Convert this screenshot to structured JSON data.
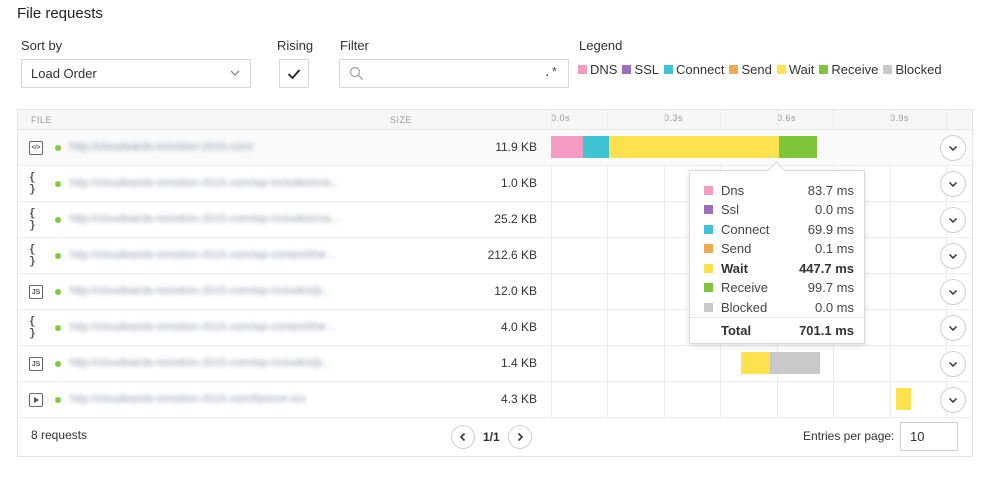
{
  "title": "File requests",
  "controls": {
    "sort_label": "Sort by",
    "sort_value": "Load Order",
    "rising_label": "Rising",
    "filter_label": "Filter",
    "filter_value": "",
    "filter_regex": ".*",
    "legend_label": "Legend"
  },
  "legend": [
    {
      "name": "DNS",
      "color": "#f49bc4"
    },
    {
      "name": "SSL",
      "color": "#9b6fbe"
    },
    {
      "name": "Connect",
      "color": "#3fc4d4"
    },
    {
      "name": "Send",
      "color": "#f0ab4e"
    },
    {
      "name": "Wait",
      "color": "#fde24d"
    },
    {
      "name": "Receive",
      "color": "#7fc53a"
    },
    {
      "name": "Blocked",
      "color": "#c9c9c9"
    }
  ],
  "table": {
    "col_file": "FILE",
    "col_size": "SIZE",
    "ticks": [
      "0.0s",
      "0.3s",
      "0.6s",
      "0.9s"
    ],
    "rows": [
      {
        "icon": "html",
        "url": "http://cloudwards-inmotion-2015.com/",
        "size": "11.9 KB",
        "bars": [
          {
            "type": "dns",
            "start": 0,
            "dur": 0.0837
          },
          {
            "type": "connect",
            "start": 0.0837,
            "dur": 0.0699
          },
          {
            "type": "send",
            "start": 0.1536,
            "dur": 0.0001
          },
          {
            "type": "wait",
            "start": 0.1537,
            "dur": 0.4477
          },
          {
            "type": "receive",
            "start": 0.6014,
            "dur": 0.0997
          }
        ]
      },
      {
        "icon": "json",
        "url": "http://cloudwards-inmotion-2015.com/wp-includes/css...",
        "size": "1.0 KB",
        "bars": []
      },
      {
        "icon": "json",
        "url": "http://cloudwards-inmotion-2015.com/wp-includes/css...",
        "size": "25.2 KB",
        "bars": []
      },
      {
        "icon": "json",
        "url": "http://cloudwards-inmotion-2015.com/wp-content/the...",
        "size": "212.6 KB",
        "bars": [
          {
            "type": "receive",
            "start": 0.72,
            "dur": 0.028
          },
          {
            "type": "blocked",
            "start": 0.748,
            "dur": 0.062
          }
        ]
      },
      {
        "icon": "js",
        "url": "http://cloudwards-inmotion-2015.com/wp-includes/js...",
        "size": "12.0 KB",
        "bars": []
      },
      {
        "icon": "json",
        "url": "http://cloudwards-inmotion-2015.com/wp-content/the...",
        "size": "4.0 KB",
        "bars": []
      },
      {
        "icon": "js",
        "url": "http://cloudwards-inmotion-2015.com/wp-includes/js...",
        "size": "1.4 KB",
        "bars": [
          {
            "type": "send",
            "start": 0.5,
            "dur": 0.002
          },
          {
            "type": "wait",
            "start": 0.502,
            "dur": 0.0755
          },
          {
            "type": "blocked",
            "start": 0.5775,
            "dur": 0.1325
          }
        ]
      },
      {
        "icon": "media",
        "url": "http://cloudwards-inmotion-2015.com/favicon.ico",
        "size": "4.3 KB",
        "bars": [
          {
            "type": "wait",
            "start": 0.91,
            "dur": 0.04
          }
        ]
      }
    ]
  },
  "timeline": {
    "max_seconds": 1.11
  },
  "tooltip": {
    "rows": [
      {
        "name": "Dns",
        "value": "83.7 ms",
        "color": "#f49bc4",
        "bold": false
      },
      {
        "name": "Ssl",
        "value": "0.0 ms",
        "color": "#9b6fbe",
        "bold": false
      },
      {
        "name": "Connect",
        "value": "69.9 ms",
        "color": "#3fc4d4",
        "bold": false
      },
      {
        "name": "Send",
        "value": "0.1 ms",
        "color": "#f0ab4e",
        "bold": false
      },
      {
        "name": "Wait",
        "value": "447.7 ms",
        "color": "#fde24d",
        "bold": true
      },
      {
        "name": "Receive",
        "value": "99.7 ms",
        "color": "#7fc53a",
        "bold": false
      },
      {
        "name": "Blocked",
        "value": "0.0 ms",
        "color": "#c9c9c9",
        "bold": false
      }
    ],
    "total_label": "Total",
    "total_value": "701.1 ms"
  },
  "footer": {
    "count": "8 requests",
    "page": "1/1",
    "entries_label": "Entries per page:",
    "entries_value": "10"
  }
}
